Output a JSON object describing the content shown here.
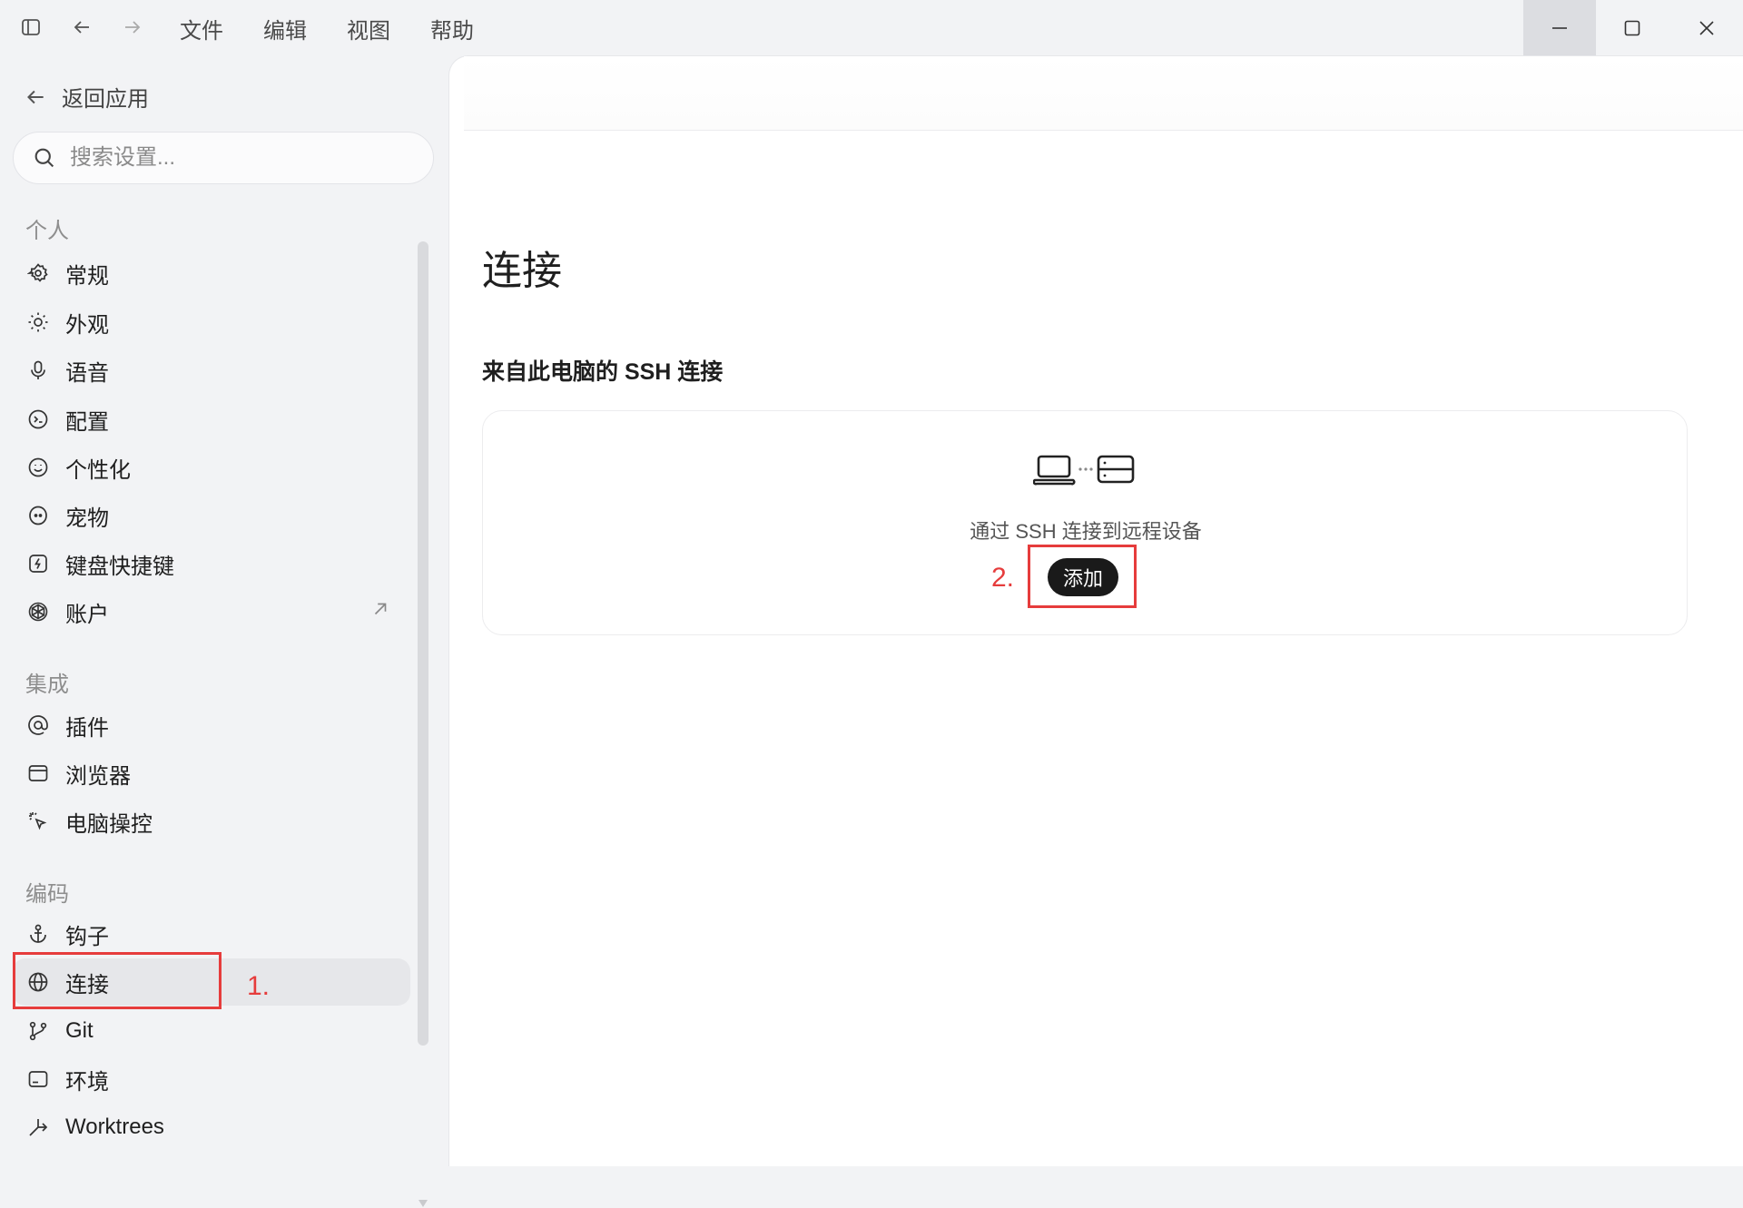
{
  "menubar": {
    "items": [
      "文件",
      "编辑",
      "视图",
      "帮助"
    ]
  },
  "sidebar": {
    "back_label": "返回应用",
    "search_placeholder": "搜索设置...",
    "sections": [
      {
        "title": "个人",
        "items": [
          {
            "label": "常规",
            "icon": "gear-icon"
          },
          {
            "label": "外观",
            "icon": "sun-icon"
          },
          {
            "label": "语音",
            "icon": "microphone-icon"
          },
          {
            "label": "配置",
            "icon": "profile-icon"
          },
          {
            "label": "个性化",
            "icon": "smile-icon"
          },
          {
            "label": "宠物",
            "icon": "pet-icon"
          },
          {
            "label": "键盘快捷键",
            "icon": "keyboard-shortcut-icon"
          },
          {
            "label": "账户",
            "icon": "openai-icon",
            "external": true
          }
        ]
      },
      {
        "title": "集成",
        "items": [
          {
            "label": "插件",
            "icon": "at-icon"
          },
          {
            "label": "浏览器",
            "icon": "browser-icon"
          },
          {
            "label": "电脑操控",
            "icon": "cursor-icon"
          }
        ]
      },
      {
        "title": "编码",
        "items": [
          {
            "label": "钩子",
            "icon": "anchor-icon"
          },
          {
            "label": "连接",
            "icon": "globe-icon",
            "active": true
          },
          {
            "label": "Git",
            "icon": "git-branch-icon"
          },
          {
            "label": "环境",
            "icon": "terminal-icon"
          },
          {
            "label": "Worktrees",
            "icon": "worktree-icon"
          }
        ]
      }
    ]
  },
  "annotations": {
    "step1": "1.",
    "step2": "2.",
    "color": "#e63c3c"
  },
  "main": {
    "title": "连接",
    "section_heading": "来自此电脑的 SSH 连接",
    "card": {
      "icon": "laptop-to-server-icon",
      "description": "通过 SSH 连接到远程设备",
      "add_label": "添加"
    }
  }
}
